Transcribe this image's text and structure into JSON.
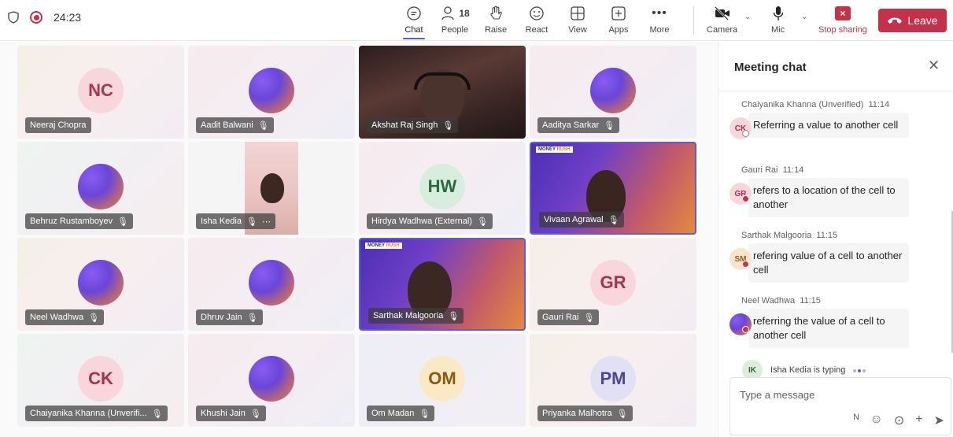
{
  "status": {
    "timer": "24:23"
  },
  "toolbar": {
    "chat": "Chat",
    "people": "People",
    "people_count": "18",
    "raise": "Raise",
    "react": "React",
    "view": "View",
    "apps": "Apps",
    "more": "More",
    "camera": "Camera",
    "mic": "Mic",
    "stop_sharing": "Stop sharing",
    "leave": "Leave"
  },
  "participants": [
    {
      "name": "Neeraj Chopra",
      "initials": "NC",
      "type": "initials",
      "avatar_bg": "#f7d7dc",
      "avatar_fg": "#a9394a",
      "muted": false
    },
    {
      "name": "Aadit Balwani",
      "type": "photo",
      "muted": true
    },
    {
      "name": "Akshat Raj Singh",
      "type": "video",
      "muted": true
    },
    {
      "name": "Aaditya Sarkar",
      "type": "photo",
      "muted": true
    },
    {
      "name": "Behruz Rustamboyev",
      "type": "photo",
      "muted": true
    },
    {
      "name": "Isha Kedia",
      "type": "video",
      "muted": true
    },
    {
      "name": "Hirdya Wadhwa (External)",
      "initials": "HW",
      "type": "initials",
      "avatar_bg": "#d7eedf",
      "avatar_fg": "#2a6b3e",
      "muted": true
    },
    {
      "name": "Vivaan Agrawal",
      "type": "video",
      "muted": true
    },
    {
      "name": "Neel Wadhwa",
      "type": "photo",
      "muted": true
    },
    {
      "name": "Dhruv Jain",
      "type": "photo",
      "muted": true
    },
    {
      "name": "Sarthak Malgooria",
      "type": "video",
      "muted": true
    },
    {
      "name": "Gauri Rai",
      "initials": "GR",
      "type": "initials",
      "avatar_bg": "#f9d6dc",
      "avatar_fg": "#a8324a",
      "muted": true
    },
    {
      "name": "Chaiyanika Khanna (Unverifi...",
      "initials": "CK",
      "type": "initials",
      "avatar_bg": "#f9d6dc",
      "avatar_fg": "#a8324a",
      "muted": true
    },
    {
      "name": "Khushi Jain",
      "type": "photo",
      "muted": true
    },
    {
      "name": "Om Madan",
      "initials": "OM",
      "type": "initials",
      "avatar_bg": "#fbe8c5",
      "avatar_fg": "#8a5a10",
      "muted": true
    },
    {
      "name": "Priyanka Malhotra",
      "initials": "PM",
      "type": "initials",
      "avatar_bg": "#e2e0f5",
      "avatar_fg": "#4c4694",
      "muted": true
    }
  ],
  "video_brand": {
    "prefix": "MONEY ",
    "highlight": "RUSH"
  },
  "chat": {
    "title": "Meeting chat",
    "messages": [
      {
        "author": "Chaiyanika Khanna (Unverified)",
        "time": "11:14",
        "initials": "CK",
        "text": "Referring a value to another cell"
      },
      {
        "author": "Gauri Rai",
        "time": "11:14",
        "initials": "GR",
        "text": "refers to a location of the cell to another"
      },
      {
        "author": "Sarthak Malgooria",
        "time": "11:15",
        "initials": "SM",
        "text": "refering value of a cell to another cell"
      },
      {
        "author": "Neel Wadhwa",
        "time": "11:15",
        "initials": "",
        "text": "referring the value of a cell to another cell"
      }
    ],
    "typing_initials": "IK",
    "typing_text": "Isha Kedia is typing",
    "input_placeholder": "Type a message"
  },
  "colors": {
    "accent": "#5b5fc7",
    "leave": "#c4314b",
    "recording": "#c4314b"
  }
}
